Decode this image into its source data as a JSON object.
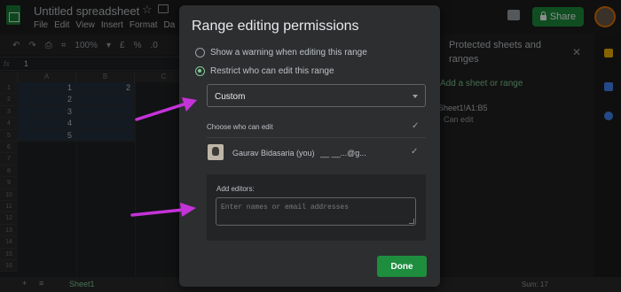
{
  "app": {
    "doc_title": "Untitled spreadsheet",
    "menu": [
      "File",
      "Edit",
      "View",
      "Insert",
      "Format",
      "Da"
    ],
    "share_label": "Share",
    "toolbar": [
      "↶",
      "↷",
      "⎙",
      "⌗",
      "100%",
      "▾",
      "£",
      "%",
      ".0"
    ],
    "formula_fx": "fx",
    "formula_value": "1",
    "columns": [
      "A",
      "B",
      "C"
    ],
    "rows": [
      "1",
      "2",
      "3",
      "4",
      "5",
      "6",
      "7",
      "8",
      "9",
      "10",
      "11",
      "12",
      "13",
      "14",
      "15",
      "16"
    ],
    "cells": {
      "A1": "1",
      "B1": "2",
      "A2": "2",
      "A3": "3",
      "A4": "4",
      "A5": "5"
    },
    "sheet_tab": "Sheet1",
    "sum_label": "Sum: 17",
    "add_sheet_icon": "+",
    "sheets_list_icon": "≡"
  },
  "side_panel": {
    "title": "Protected sheets and ranges",
    "add_link": "Add a sheet or range",
    "range": "Sheet1!A1:B5",
    "can_edit": "Can edit"
  },
  "modal": {
    "title": "Range editing permissions",
    "option_warning": "Show a warning when editing this range",
    "option_restrict": "Restrict who can edit this range",
    "dropdown_value": "Custom",
    "choose_label": "Choose who can edit",
    "editor_name": "Gaurav Bidasaria (you)",
    "editor_email": "__  __...@g...",
    "add_editors_label": "Add editors:",
    "add_editors_placeholder": "Enter names or email addresses",
    "done_label": "Done"
  },
  "colors": {
    "accent_green": "#1e8e3e",
    "radio_green": "#81c995",
    "arrow_magenta": "#c433d8"
  }
}
